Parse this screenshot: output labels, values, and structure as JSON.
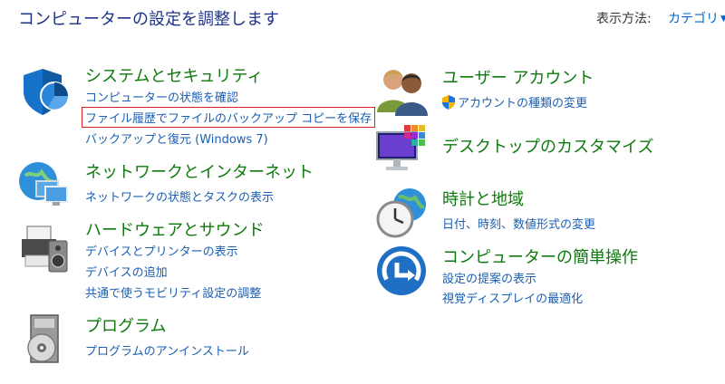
{
  "header": {
    "title": "コンピューターの設定を調整します",
    "view_by_label": "表示方法:",
    "view_by_value": "カテゴリ"
  },
  "categories": [
    {
      "title": "システムとセキュリティ",
      "icon": "shield-pie-icon",
      "links": [
        "コンピューターの状態を確認",
        "ファイル履歴でファイルのバックアップ コピーを保存",
        "バックアップと復元 (Windows 7)"
      ]
    },
    {
      "title": "ネットワークとインターネット",
      "icon": "network-globe-icon",
      "links": [
        "ネットワークの状態とタスクの表示"
      ]
    },
    {
      "title": "ハードウェアとサウンド",
      "icon": "printer-speaker-icon",
      "links": [
        "デバイスとプリンターの表示",
        "デバイスの追加",
        "共通で使うモビリティ設定の調整"
      ]
    },
    {
      "title": "プログラム",
      "icon": "program-disc-icon",
      "links": [
        "プログラムのアンインストール"
      ]
    },
    {
      "title": "ユーザー アカウント",
      "icon": "users-icon",
      "links": [
        "アカウントの種類の変更"
      ]
    },
    {
      "title": "デスクトップのカスタマイズ",
      "icon": "monitor-palette-icon",
      "links": []
    },
    {
      "title": "時計と地域",
      "icon": "clock-globe-icon",
      "links": [
        "日付、時刻、数値形式の変更"
      ]
    },
    {
      "title": "コンピューターの簡単操作",
      "icon": "ease-of-access-icon",
      "links": [
        "設定の提案の表示",
        "視覚ディスプレイの最適化"
      ]
    }
  ],
  "colors": {
    "title": "#1e3287",
    "category": "#0e7a0d",
    "link": "#1a5fb4",
    "highlight_box": "#e02020"
  }
}
